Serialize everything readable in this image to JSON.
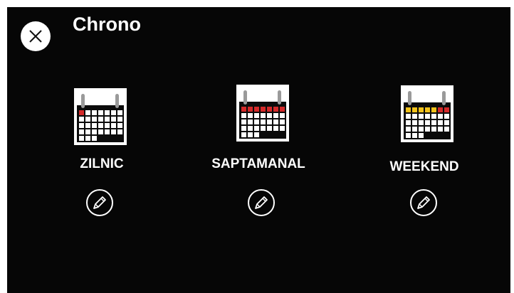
{
  "app": {
    "title": "Chrono"
  },
  "icons": {
    "close": "close-icon",
    "calendar": "calendar-icon",
    "edit": "pencil-icon"
  },
  "colors": {
    "background": "#060606",
    "accent_red": "#d42a2a",
    "accent_yellow": "#f2c21b",
    "text": "#ffffff"
  },
  "modes": [
    {
      "id": "daily",
      "label": "ZILNIC",
      "highlight": "first-day"
    },
    {
      "id": "weekly",
      "label": "SAPTAMANAL",
      "highlight": "full-week"
    },
    {
      "id": "weekend",
      "label": "WEEKEND",
      "highlight": "weekdays-yellow-weekend-red"
    }
  ]
}
